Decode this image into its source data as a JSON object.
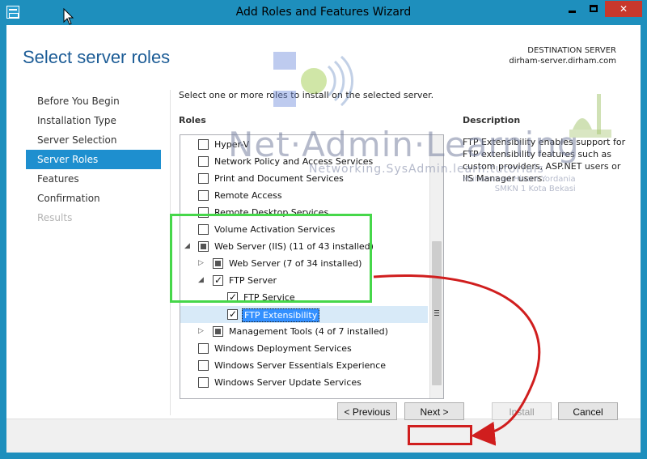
{
  "window": {
    "title": "Add Roles and Features Wizard",
    "controls": {
      "minimize": "minimize",
      "maximize": "maximize",
      "close": "✕"
    }
  },
  "header": {
    "page_title": "Select server roles",
    "destination_label": "DESTINATION SERVER",
    "destination_server": "dirham-server.dirham.com"
  },
  "nav": {
    "items": [
      {
        "label": "Before You Begin",
        "state": "normal"
      },
      {
        "label": "Installation Type",
        "state": "normal"
      },
      {
        "label": "Server Selection",
        "state": "normal"
      },
      {
        "label": "Server Roles",
        "state": "active"
      },
      {
        "label": "Features",
        "state": "normal"
      },
      {
        "label": "Confirmation",
        "state": "normal"
      },
      {
        "label": "Results",
        "state": "disabled"
      }
    ]
  },
  "main": {
    "intro": "Select one or more roles to install on the selected server.",
    "roles_heading": "Roles",
    "description_heading": "Description",
    "description_text": "FTP Extensibility enables support for FTP extensibility features such as custom providers, ASP.NET users or IIS Manager users.",
    "roles": [
      {
        "label": "Hyper-V",
        "state": "unchecked",
        "level": 0
      },
      {
        "label": "Network Policy and Access Services",
        "state": "unchecked",
        "level": 0
      },
      {
        "label": "Print and Document Services",
        "state": "unchecked",
        "level": 0
      },
      {
        "label": "Remote Access",
        "state": "unchecked",
        "level": 0
      },
      {
        "label": "Remote Desktop Services",
        "state": "unchecked",
        "level": 0
      },
      {
        "label": "Volume Activation Services",
        "state": "unchecked",
        "level": 0
      },
      {
        "label": "Web Server (IIS) (11 of 43 installed)",
        "state": "partial",
        "level": 0,
        "expander": "expanded"
      },
      {
        "label": "Web Server (7 of 34 installed)",
        "state": "partial",
        "level": 1,
        "expander": "collapsed"
      },
      {
        "label": "FTP Server",
        "state": "checked",
        "level": 1,
        "expander": "expanded"
      },
      {
        "label": "FTP Service",
        "state": "checked",
        "level": 2
      },
      {
        "label": "FTP Extensibility",
        "state": "checked",
        "level": 2,
        "selected": true
      },
      {
        "label": "Management Tools (4 of 7 installed)",
        "state": "partial",
        "level": 1,
        "expander": "collapsed"
      },
      {
        "label": "Windows Deployment Services",
        "state": "unchecked",
        "level": 0
      },
      {
        "label": "Windows Server Essentials Experience",
        "state": "unchecked",
        "level": 0
      },
      {
        "label": "Windows Server Update Services",
        "state": "unchecked",
        "level": 0
      }
    ]
  },
  "footer": {
    "previous_label": "< Previous",
    "next_label": "Next >",
    "install_label": "Install",
    "cancel_label": "Cancel"
  },
  "watermark": {
    "title": "Net·Admin·Learning",
    "subtitle": "Networking.SysAdmin.learn.tutorials",
    "credit_line1": "Muhammad Hisam Yordania",
    "credit_line2": "SMKN 1 Kota Bekasi"
  },
  "colors": {
    "accent": "#1e8fcf",
    "title_blue": "#1c5c96",
    "annotation_green": "#46d74a",
    "annotation_red": "#d01e1e",
    "close_red": "#c8382c"
  }
}
